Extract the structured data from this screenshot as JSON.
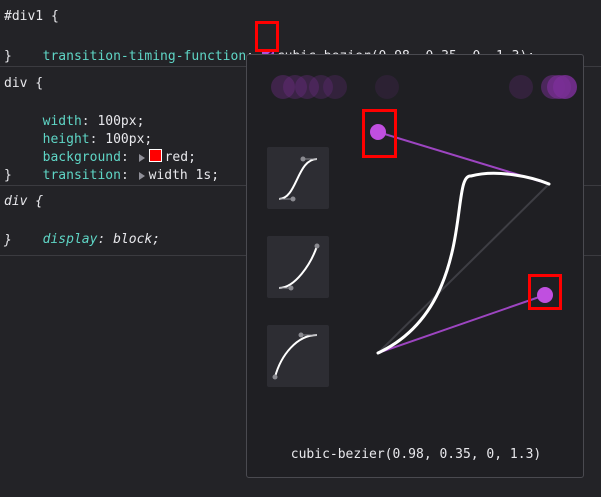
{
  "rules": [
    {
      "selector": "#div1 {",
      "declarations": [
        {
          "property": "transition-timing-function",
          "value": "cubic-bezier(0.98, 0.35, 0, 1.3);"
        }
      ],
      "close": "}"
    },
    {
      "selector": "div {",
      "declarations": [
        {
          "property": "width",
          "value": "100px;"
        },
        {
          "property": "height",
          "value": "100px;"
        },
        {
          "property": "background",
          "value": "red;"
        },
        {
          "property": "transition",
          "value": "width 1s;"
        }
      ],
      "close": "}"
    },
    {
      "selector": "div {",
      "declarations": [
        {
          "property": "display",
          "value": "block;"
        }
      ],
      "close": "}"
    }
  ],
  "colors": {
    "background_swatch": "#ff0000",
    "accent": "#b14ed7",
    "highlight": "#ff0000"
  },
  "bezier_editor": {
    "function": [
      0.98,
      0.35,
      0,
      1.3
    ],
    "readout": "cubic-bezier(0.98, 0.35, 0, 1.3)",
    "presets": [
      "ease-in-out-preset",
      "ease-in-preset",
      "ease-out-preset"
    ]
  }
}
